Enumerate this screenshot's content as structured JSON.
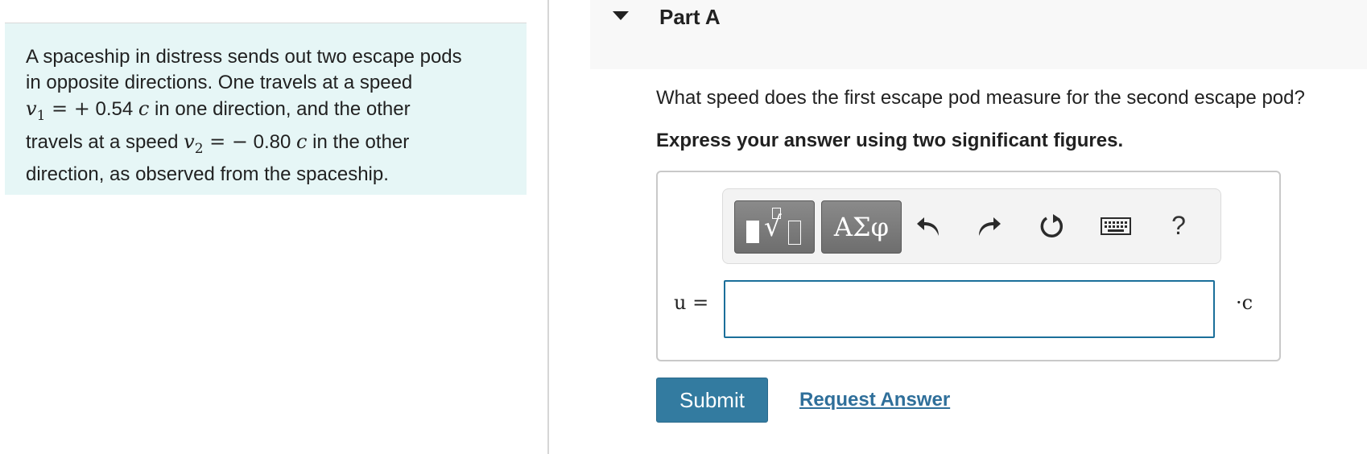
{
  "problem": {
    "line1": "A spaceship in distress sends out two escape pods",
    "line2": "in opposite directions. One travels at a speed",
    "v1_symbol": "v",
    "v1_subscript": "1",
    "v1_equals": " = ",
    "v1_sign": "+",
    "v1_value": " 0.54 ",
    "v1_c": "c",
    "line3_rest": " in one direction, and the other",
    "line4_start": "travels at a speed ",
    "v2_symbol": "v",
    "v2_subscript": "2",
    "v2_equals": " = ",
    "v2_sign": "−",
    "v2_value": " 0.80 ",
    "v2_c": "c",
    "line4_rest": " in the other",
    "line5": "direction, as observed from the spaceship."
  },
  "part": {
    "title": "Part A"
  },
  "question": {
    "text": "What speed does the first escape pod measure for the second escape pod?",
    "instruction": "Express your answer using two significant figures."
  },
  "toolbar": {
    "symbols_label": "ΑΣφ",
    "help_label": "?"
  },
  "answer": {
    "variable_label": "u =",
    "value": "",
    "unit_label": "·c"
  },
  "actions": {
    "submit_label": "Submit",
    "request_label": "Request Answer"
  },
  "colors": {
    "problem_bg": "#e6f6f6",
    "submit_bg": "#337ba0",
    "link": "#2f6f9a",
    "input_border": "#1b6f9a"
  },
  "icons": [
    "caret-down-icon",
    "templates-icon",
    "undo-icon",
    "redo-icon",
    "reset-icon",
    "keyboard-icon",
    "help-icon"
  ]
}
